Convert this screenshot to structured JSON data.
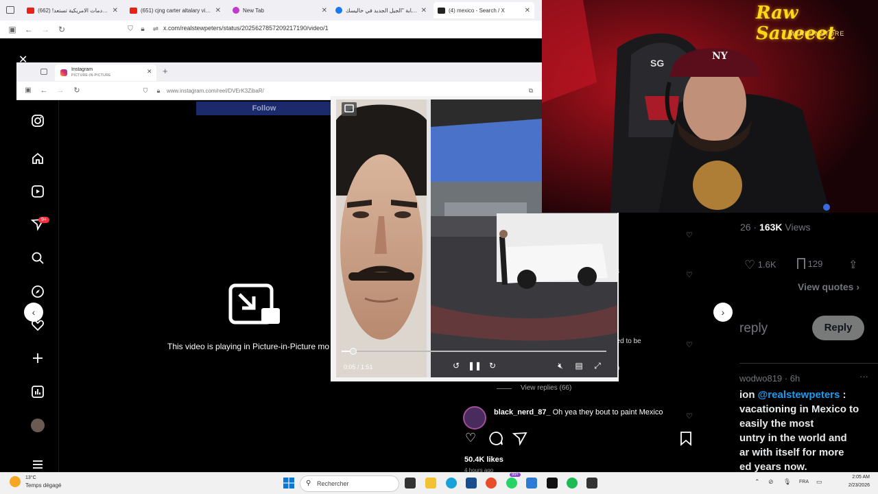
{
  "outer_browser": {
    "tabs": [
      {
        "title": "القادمات الامريكية تستعد! (662)",
        "favicon": "youtube"
      },
      {
        "title": "(651) cjng carter altalary video",
        "favicon": "youtube"
      },
      {
        "title": "New Tab",
        "favicon": "firefox"
      },
      {
        "title": "عصابة \"الجيل الجديد في خاليسك",
        "favicon": "facebook"
      },
      {
        "title": "(4) mexico - Search / X",
        "favicon": "x"
      }
    ],
    "url": "x.com/realstewpeters/status/2025627857209217190/video/1",
    "close_glyph": "✕"
  },
  "inner_browser": {
    "tab_title": "Instagram",
    "tab_subtitle": "PICTURE-IN-PICTURE",
    "url": "www.instagram.com/reel/DVErK3ZibaR/",
    "follow_label": "Follow",
    "notification_badge": "9+",
    "pip_message": "This video is playing in Picture-in-Picture mo"
  },
  "pip_player": {
    "time": "0:05 / 1:51",
    "progress_fraction": 0.045
  },
  "ig_comments": {
    "fragment_1": "s",
    "fragment_2": "eed to be",
    "fragment_3": "n",
    "view_replies": "View replies (66)",
    "comment_user": "black_nerd_87_",
    "comment_text": "Oh yea they bout to paint Mexico",
    "likes": "50.4K likes",
    "time_partial": "4 hours ago"
  },
  "x_panel": {
    "views_prefix": "26",
    "views_count": "163K",
    "views_label": "Views",
    "likes": "1.6K",
    "bookmarks": "129",
    "view_quotes": "View quotes",
    "reply_placeholder": "reply",
    "reply_button": "Reply",
    "reply_handle": "wodwo819 · 6h",
    "reply_line1_prefix": "ion",
    "reply_mention": "@realstewpeters",
    "reply_line1_suffix": ":",
    "reply_line2": "vacationing in Mexico to",
    "reply_line3": "easily the most",
    "reply_line4": "untry in the world and",
    "reply_line5": "ar with itself for more",
    "reply_line6": "ed years now."
  },
  "webcam": {
    "logo": "Raw Saueeet",
    "logo_sub": "MYNEONSTORE",
    "cap_logo": "NY",
    "chair_logo": "SG"
  },
  "taskbar": {
    "weather_temp": "13°C",
    "weather_desc": "Temps dégagé",
    "search_placeholder": "Rechercher",
    "language": "FRA",
    "time": "2:05 AM",
    "date": "2/23/2026",
    "badge": "99+"
  },
  "colors": {
    "x_link": "#1d9bf0",
    "instagram_follow": "#1a2a6a",
    "notification": "#ff3040"
  }
}
